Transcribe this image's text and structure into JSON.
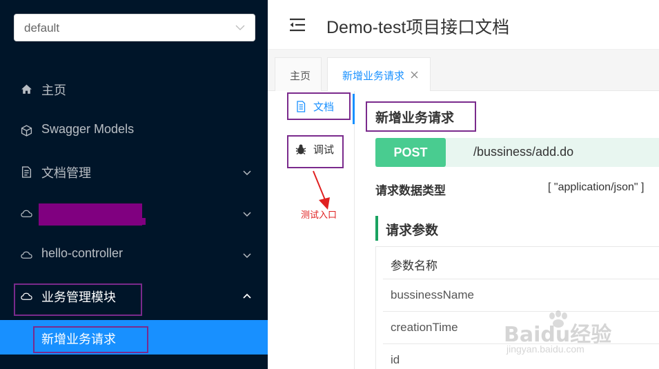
{
  "sidebar": {
    "group_select": {
      "value": "default"
    },
    "items": [
      {
        "label": "主页",
        "icon": "home-icon"
      },
      {
        "label": "Swagger Models",
        "icon": "cube-icon"
      },
      {
        "label": "文档管理",
        "icon": "document-icon"
      },
      {
        "label": "",
        "icon": "cloud-icon"
      },
      {
        "label": "hello-controller",
        "icon": "cloud-icon"
      },
      {
        "label": "业务管理模块",
        "icon": "cloud-icon"
      }
    ],
    "sub_item": {
      "label": "新增业务请求"
    }
  },
  "header": {
    "title": "Demo-test项目接口文档"
  },
  "tabs": [
    {
      "label": "主页"
    },
    {
      "label": "新增业务请求",
      "closable": true
    }
  ],
  "side_tabs": [
    {
      "label": "文档",
      "icon": "document-icon"
    },
    {
      "label": "调试",
      "icon": "bug-icon"
    }
  ],
  "annotation": {
    "text": "测试入口"
  },
  "doc": {
    "title": "新增业务请求",
    "method": "POST",
    "url": "/bussiness/add.do",
    "content_type_label": "请求数据类型",
    "content_type_value": "[ \"application/json\" ]",
    "params_title": "请求参数",
    "params_header": "参数名称",
    "params": [
      "bussinessName",
      "creationTime",
      "id"
    ]
  },
  "watermark": {
    "text": "Baidu经验",
    "sub": "jingyan.baidu.com"
  },
  "colors": {
    "sidebar_bg": "#001529",
    "accent": "#1890ff",
    "post": "#49cc90",
    "annotation_box": "#7a2a8c",
    "annotation_arrow": "#e02020"
  }
}
